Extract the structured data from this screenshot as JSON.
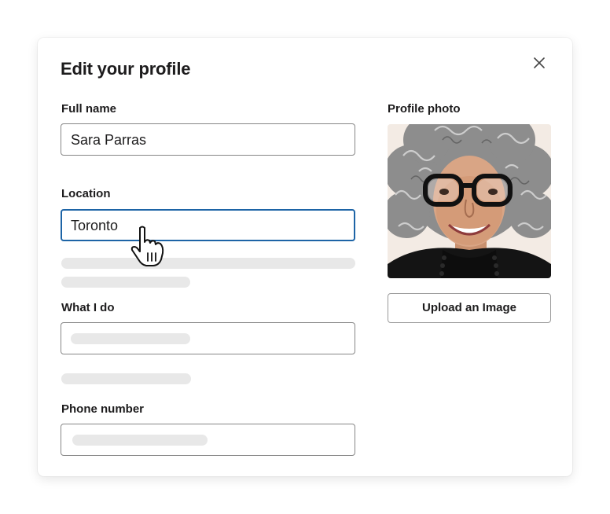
{
  "dialog": {
    "title": "Edit your profile",
    "close_icon": "close-icon"
  },
  "fields": {
    "full_name": {
      "label": "Full name",
      "value": "Sara Parras"
    },
    "location": {
      "label": "Location",
      "value": "Toronto"
    },
    "what_i_do": {
      "label": "What I do",
      "value": ""
    },
    "phone_number": {
      "label": "Phone number",
      "value": ""
    }
  },
  "photo": {
    "label": "Profile photo",
    "upload_label": "Upload an Image"
  },
  "cursor_icon": "pointer-hand-icon",
  "colors": {
    "focus_border": "#1d64a6",
    "input_border": "#868686",
    "skeleton": "#e8e8e8"
  }
}
